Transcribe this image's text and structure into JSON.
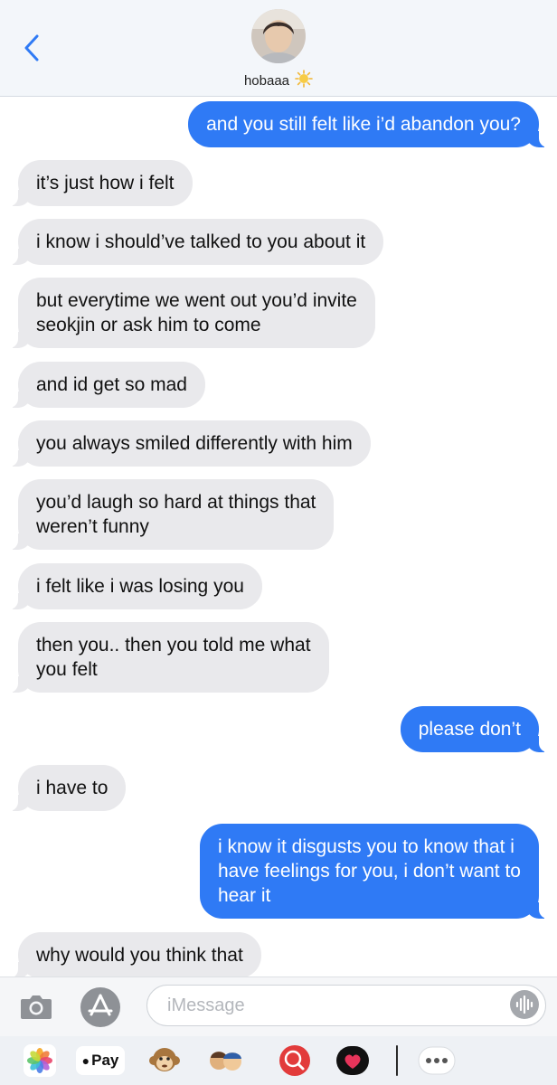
{
  "header": {
    "contact_name": "hobaaa",
    "contact_emoji": "☀️"
  },
  "messages": [
    {
      "dir": "out",
      "text": "and you still felt like i’d abandon you?"
    },
    {
      "dir": "in",
      "text": "it’s just how i felt"
    },
    {
      "dir": "in",
      "text": "i know i should’ve talked to you about it"
    },
    {
      "dir": "in",
      "text": "but everytime we went out you’d invite\nseokjin or ask him to come"
    },
    {
      "dir": "in",
      "text": "and id get so mad"
    },
    {
      "dir": "in",
      "text": "you always smiled differently with him"
    },
    {
      "dir": "in",
      "text": "you’d laugh so hard at things that\nweren’t funny"
    },
    {
      "dir": "in",
      "text": "i felt like i was losing you"
    },
    {
      "dir": "in",
      "text": "then you.. then you told me what\nyou felt"
    },
    {
      "dir": "out",
      "text": "please don’t"
    },
    {
      "dir": "in",
      "text": "i have to"
    },
    {
      "dir": "out",
      "text": "i know it disgusts you to know that i\nhave feelings for you, i don’t want to\nhear it"
    },
    {
      "dir": "in",
      "text": "why would you think that"
    }
  ],
  "composer": {
    "placeholder": "iMessage"
  },
  "tray": {
    "apple_pay_label": "Pay"
  },
  "colors": {
    "sent_bubble": "#2f7af5",
    "received_bubble": "#e9e9ec",
    "ios_blue": "#2f7af5"
  },
  "icons": [
    "chevron-left-icon",
    "camera-icon",
    "app-store-icon",
    "audio-waveform-icon",
    "photos-icon",
    "apple-pay-icon",
    "monkey-sticker-icon",
    "memoji-icon",
    "web-search-icon",
    "heart-sticker-icon",
    "more-icon"
  ]
}
